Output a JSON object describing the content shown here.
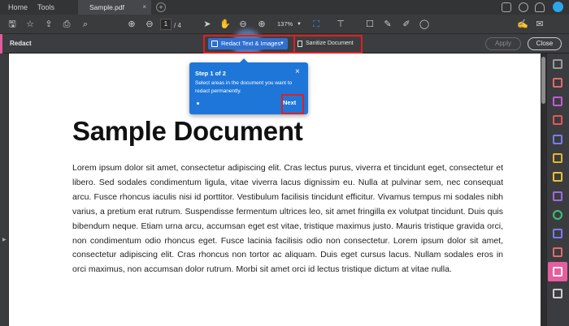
{
  "menu": {
    "home": "Home",
    "tools": "Tools"
  },
  "tab": {
    "name": "Sample.pdf",
    "close": "×",
    "add": "+"
  },
  "toolbar": {
    "current_page": "1",
    "page_total": "/ 4",
    "zoom": "137%"
  },
  "redact_bar": {
    "label": "Redact",
    "redact_button": "Redact Text & Images",
    "sanitize_button": "Sanitize Document",
    "apply_button": "Apply",
    "close_button": "Close"
  },
  "tooltip": {
    "step": "Step 1 of 2",
    "close": "×",
    "text": "Select areas in the document you want to redact permanently.",
    "next": "Next"
  },
  "document": {
    "title": "Sample Document",
    "body": "Lorem ipsum dolor sit amet, consectetur adipiscing elit. Cras lectus purus, viverra et tincidunt eget, consectetur et libero. Sed sodales condimentum ligula, vitae viverra lacus dignissim eu. Nulla at pulvinar sem, nec consequat arcu. Fusce rhoncus iaculis nisi id porttitor. Vestibulum facilisis tincidunt efficitur. Vivamus tempus mi sodales nibh varius, a pretium erat rutrum. Suspendisse fermentum ultrices leo, sit amet fringilla ex volutpat tincidunt. Duis quis bibendum neque. Etiam urna arcu, accumsan eget est vitae, tristique maximus justo. Mauris tristique gravida orci, non condimentum odio rhoncus eget. Fusce lacinia facilisis odio non consectetur. Lorem ipsum dolor sit amet, consectetur adipiscing elit. Cras rhoncus non tortor ac aliquam. Duis eget cursus lacus. Nullam sodales eros in orci maximus, non accumsan dolor rutrum. Morbi sit amet orci id lectus tristique dictum at vitae nulla."
  },
  "colors": {
    "accent_blue": "#1e76d8",
    "highlight_red": "#e02020",
    "active_tool_pink": "#e55ea0"
  },
  "icons": {
    "toolbar": [
      "save-icon",
      "bookmark-star-icon",
      "upload-icon",
      "print-icon",
      "search-icon",
      "page-up-icon",
      "page-down-icon",
      "pointer-icon",
      "hand-icon",
      "zoom-out-icon",
      "zoom-in-icon",
      "fit-page-icon",
      "stamp-icon",
      "comment-icon",
      "highlight-pen-icon",
      "markup-pen-icon",
      "shape-icon"
    ],
    "right_panel": [
      "export-pdf-icon",
      "edit-pdf-icon",
      "create-pdf-icon",
      "combine-icon",
      "organize-pages-icon",
      "comment-icon",
      "fill-sign-icon",
      "scan-ocr-icon",
      "protect-icon",
      "compress-icon",
      "redact-icon"
    ]
  }
}
